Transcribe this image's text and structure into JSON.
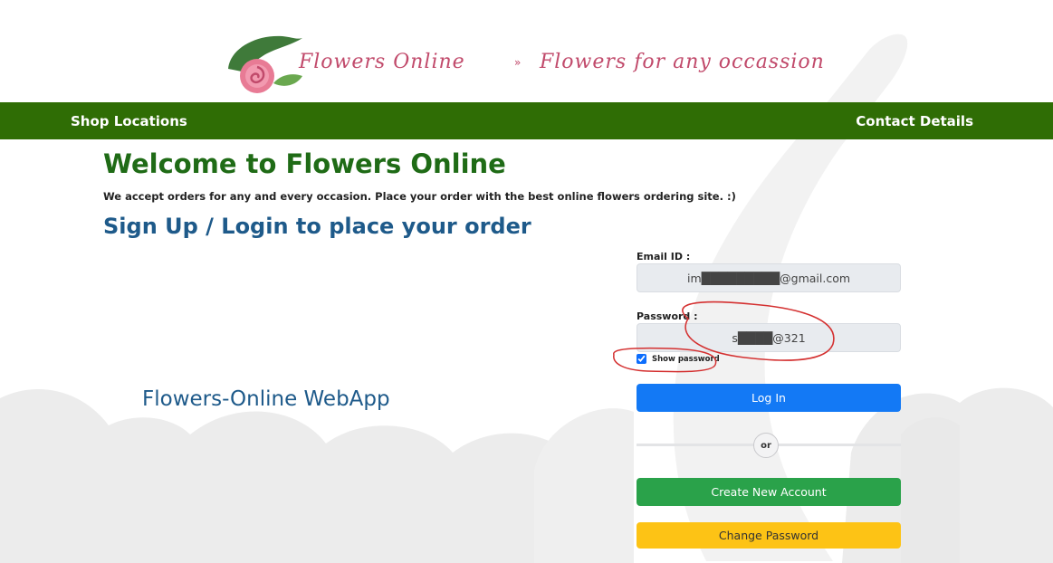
{
  "logo": {
    "brand": "Flowers Online",
    "separator": "»",
    "tagline": "Flowers for any occassion"
  },
  "nav": {
    "left_link": "Shop Locations",
    "right_link": "Contact Details"
  },
  "main": {
    "welcome_title": "Welcome to Flowers Online",
    "welcome_subtitle": "We accept orders for any and every occasion. Place your order with the best online flowers ordering site. :)",
    "signup_heading": "Sign Up / Login to place your order",
    "webapp_label": "Flowers-Online WebApp"
  },
  "form": {
    "email_label": "Email ID :",
    "email_value": "im█████████@gmail.com",
    "password_label": "Password :",
    "password_value": "s████@321",
    "show_password_label": "Show password",
    "show_password_checked": true,
    "login_button": "Log In",
    "or_text": "or",
    "create_account_button": "Create New Account",
    "change_password_button": "Change Password"
  },
  "colors": {
    "nav_green": "#2f6d05",
    "title_green": "#1f6b16",
    "heading_blue": "#1e5a8a",
    "login_blue": "#1379f5",
    "create_green": "#2aa24a",
    "change_yellow": "#fdc315",
    "annotation_red": "#d43030"
  }
}
